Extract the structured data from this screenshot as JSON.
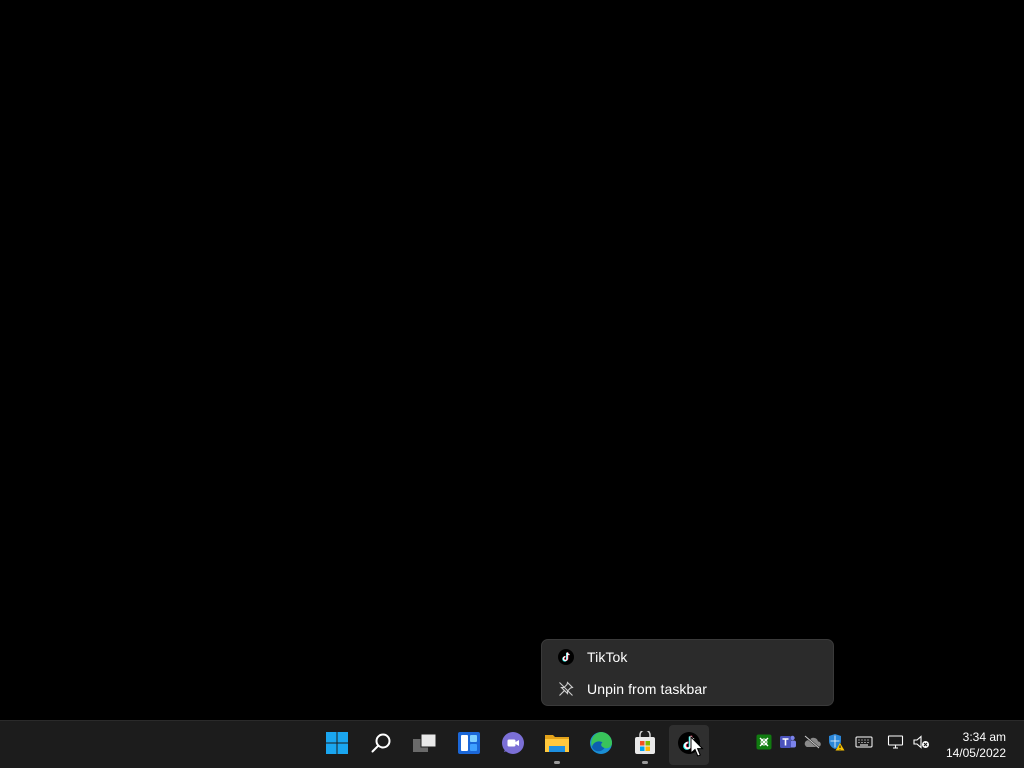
{
  "jumplist": {
    "app_label": "TikTok",
    "unpin_label": "Unpin from taskbar"
  },
  "taskbar": {
    "pinned": [
      {
        "name": "start-button",
        "icon": "windows-logo-icon"
      },
      {
        "name": "search-button",
        "icon": "search-icon"
      },
      {
        "name": "task-view-button",
        "icon": "task-view-icon"
      },
      {
        "name": "widgets-button",
        "icon": "widgets-icon"
      },
      {
        "name": "chat-button",
        "icon": "teams-chat-icon"
      },
      {
        "name": "file-explorer-button",
        "icon": "folder-icon"
      },
      {
        "name": "edge-button",
        "icon": "edge-icon"
      },
      {
        "name": "store-button",
        "icon": "microsoft-store-icon"
      },
      {
        "name": "tiktok-button",
        "icon": "tiktok-icon"
      }
    ],
    "tray": [
      {
        "name": "tray-xbox",
        "icon": "xbox-game-bar-icon"
      },
      {
        "name": "tray-teams",
        "icon": "teams-icon"
      },
      {
        "name": "tray-onedrive",
        "icon": "onedrive-offline-icon"
      },
      {
        "name": "tray-security",
        "icon": "windows-security-warning-icon"
      },
      {
        "name": "tray-keyboard",
        "icon": "keyboard-icon"
      },
      {
        "name": "tray-network",
        "icon": "network-icon"
      },
      {
        "name": "tray-volume",
        "icon": "volume-muted-icon"
      }
    ],
    "clock": {
      "time": "3:34 am",
      "date": "14/05/2022"
    }
  },
  "colors": {
    "desktop": "#000000",
    "taskbar": "#1c1c1c",
    "menu": "#2b2b2b",
    "accent": "#0078d4"
  }
}
